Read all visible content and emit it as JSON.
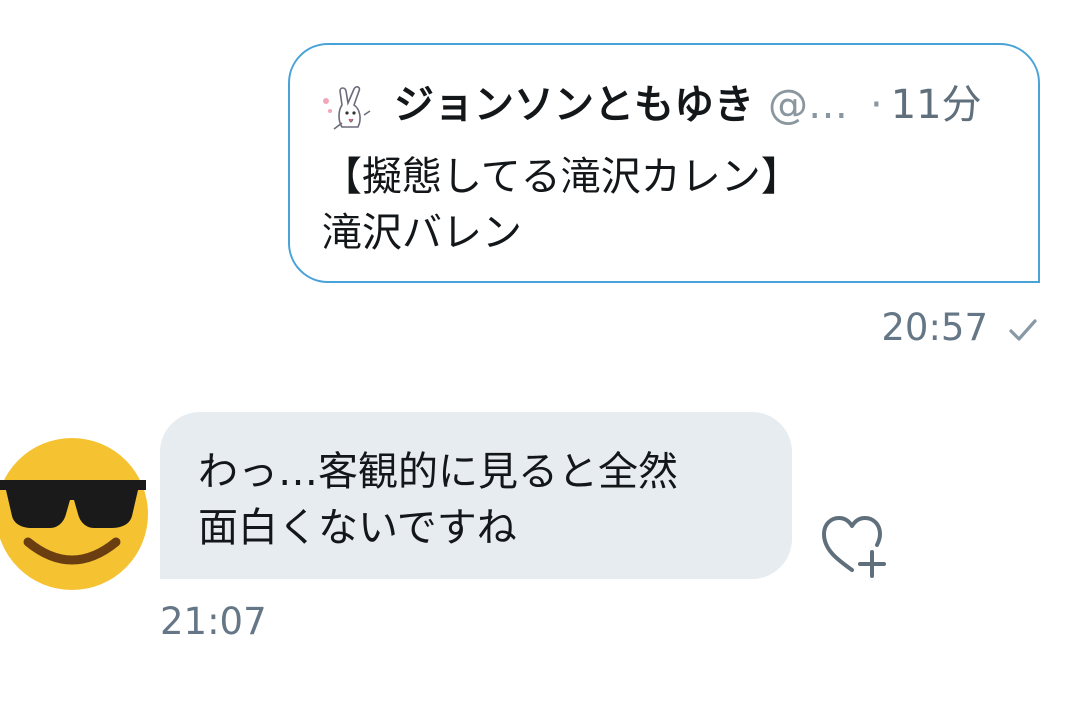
{
  "sent_message": {
    "quote": {
      "author_name": "ジョンソンともゆき",
      "handle": "@…",
      "separator": "·",
      "time_ago": "11分",
      "text_line1": "【擬態してる滝沢カレン】",
      "text_line2": "滝沢バレン",
      "avatar_icon": "rabbit-avatar-icon"
    },
    "timestamp": "20:57",
    "status_icon": "checkmark-icon"
  },
  "received_message": {
    "avatar_icon": "sunglasses-emoji-icon",
    "text_line1": "わっ…客観的に見ると全然",
    "text_line2": "面白くないですね",
    "timestamp": "21:07",
    "reaction_icon": "heart-plus-icon"
  },
  "colors": {
    "quote_border": "#4aa3d8",
    "received_bubble_bg": "#e6ecf0",
    "meta_text": "#657786",
    "emoji_yellow": "#f5c332"
  }
}
